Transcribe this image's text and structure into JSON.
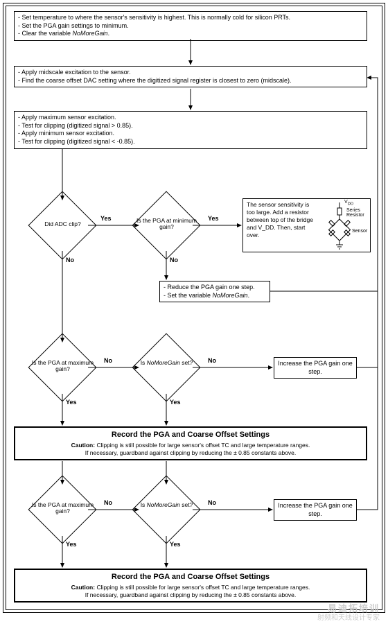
{
  "box1": {
    "l1": "- Set temperature to where the sensor's sensitivity is highest. This is normally cold for silicon PRTs.",
    "l2": "- Set the PGA gain settings to minimum.",
    "l3": "- Clear the variable NoMoreGain."
  },
  "box2": {
    "l1": "- Apply midscale excitation to the sensor.",
    "l2": "- Find the coarse offset DAC setting where the digitized signal register is closest to zero (midscale)."
  },
  "box3": {
    "l1": "- Apply maximum sensor excitation.",
    "l2": "- Test for clipping (digitized signal > 0.85).",
    "l3": "- Apply minimum sensor excitation.",
    "l4": "- Test for clipping (digitized signal < -0.85)."
  },
  "d1": "Did ADC clip?",
  "d2": "Is the PGA at minimum gain?",
  "d3": "Is the PGA at maximum gain?",
  "d4": "Is NoMoreGain set?",
  "d5": "Is the PGA at maximum gain?",
  "d6": "Is NoMoreGain set?",
  "sensitivity": "The sensor sensitivity is too large. Add a resistor between top of the bridge and V_DD. Then, start over.",
  "bridge": {
    "vdd": "V_DD",
    "series": "Series Resistor",
    "sensor": "Sensor"
  },
  "reduce": {
    "l1": "- Reduce the PGA gain one step.",
    "l2": "- Set the variable NoMoreGain."
  },
  "increase": "Increase the PGA gain one step.",
  "record": {
    "title": "Record the PGA and Coarse Offset Settings",
    "c1": "Caution: Clipping is still possible for large sensor's offset TC and large temperature ranges.",
    "c2": "If necessary, guardband against clipping by reducing the ± 0.85 constants above."
  },
  "yes": "Yes",
  "no": "No",
  "wm": {
    "cn": "易迪拓培训",
    "en": "射频和天线设计专家"
  }
}
